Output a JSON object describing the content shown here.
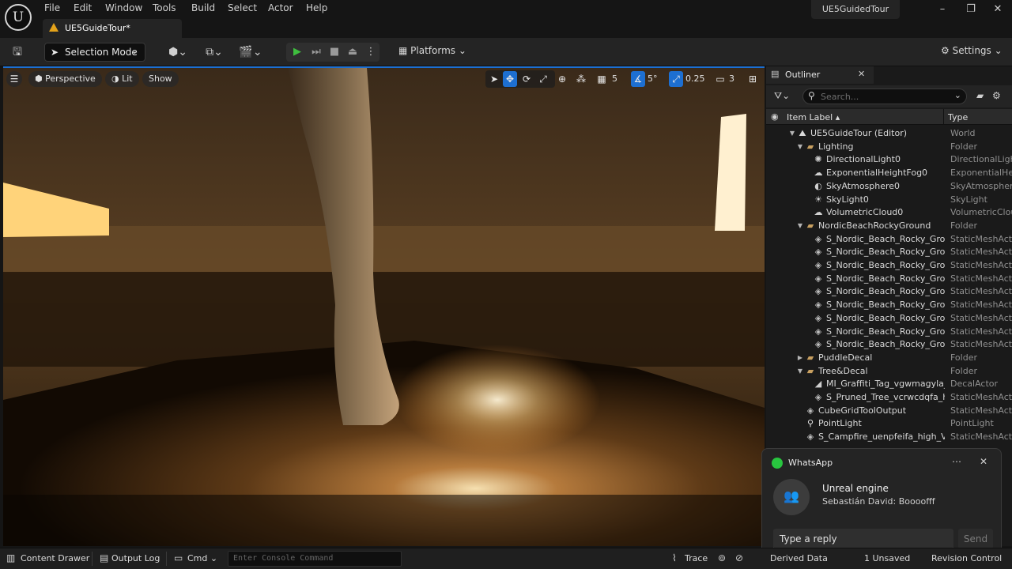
{
  "menu": {
    "items": [
      "File",
      "Edit",
      "Window",
      "Tools",
      "Build",
      "Select",
      "Actor",
      "Help"
    ]
  },
  "document_tab": {
    "label": "UE5GuideTour*"
  },
  "project_name": "UE5GuidedTour",
  "toolbar": {
    "mode": "Selection Mode",
    "platforms": "Platforms",
    "settings": "Settings"
  },
  "viewport": {
    "perspective": "Perspective",
    "lit": "Lit",
    "show": "Show",
    "grid_snap": "5",
    "angle_snap": "5°",
    "scale_snap": "0.25",
    "camera_speed": "3"
  },
  "outliner": {
    "tab_label": "Outliner",
    "search_placeholder": "Search...",
    "col_label": "Item Label ▴",
    "col_type": "Type",
    "rows": [
      {
        "depth": 0,
        "twisty": "▼",
        "icon": "⛰",
        "icon_name": "world-icon",
        "label": "UE5GuideTour (Editor)",
        "type": "World"
      },
      {
        "depth": 1,
        "twisty": "▼",
        "icon": "▰",
        "icon_name": "folder-open-icon",
        "label": "Lighting",
        "type": "Folder"
      },
      {
        "depth": 2,
        "twisty": "",
        "icon": "✺",
        "icon_name": "directional-light-icon",
        "label": "DirectionalLight0",
        "type": "DirectionalLight"
      },
      {
        "depth": 2,
        "twisty": "",
        "icon": "☁",
        "icon_name": "height-fog-icon",
        "label": "ExponentialHeightFog0",
        "type": "ExponentialHeightFog"
      },
      {
        "depth": 2,
        "twisty": "",
        "icon": "◐",
        "icon_name": "sky-atmosphere-icon",
        "label": "SkyAtmosphere0",
        "type": "SkyAtmosphere"
      },
      {
        "depth": 2,
        "twisty": "",
        "icon": "☀",
        "icon_name": "skylight-icon",
        "label": "SkyLight0",
        "type": "SkyLight"
      },
      {
        "depth": 2,
        "twisty": "",
        "icon": "☁",
        "icon_name": "volumetric-cloud-icon",
        "label": "VolumetricCloud0",
        "type": "VolumetricCloud"
      },
      {
        "depth": 1,
        "twisty": "▼",
        "icon": "▰",
        "icon_name": "folder-open-icon",
        "label": "NordicBeachRockyGround",
        "type": "Folder"
      },
      {
        "depth": 2,
        "twisty": "",
        "icon": "◈",
        "icon_name": "static-mesh-icon",
        "label": "S_Nordic_Beach_Rocky_Ground",
        "type": "StaticMeshActor"
      },
      {
        "depth": 2,
        "twisty": "",
        "icon": "◈",
        "icon_name": "static-mesh-icon",
        "label": "S_Nordic_Beach_Rocky_Ground",
        "type": "StaticMeshActor"
      },
      {
        "depth": 2,
        "twisty": "",
        "icon": "◈",
        "icon_name": "static-mesh-icon",
        "label": "S_Nordic_Beach_Rocky_Ground",
        "type": "StaticMeshActor"
      },
      {
        "depth": 2,
        "twisty": "",
        "icon": "◈",
        "icon_name": "static-mesh-icon",
        "label": "S_Nordic_Beach_Rocky_Ground",
        "type": "StaticMeshActor"
      },
      {
        "depth": 2,
        "twisty": "",
        "icon": "◈",
        "icon_name": "static-mesh-icon",
        "label": "S_Nordic_Beach_Rocky_Ground",
        "type": "StaticMeshActor"
      },
      {
        "depth": 2,
        "twisty": "",
        "icon": "◈",
        "icon_name": "static-mesh-icon",
        "label": "S_Nordic_Beach_Rocky_Ground",
        "type": "StaticMeshActor"
      },
      {
        "depth": 2,
        "twisty": "",
        "icon": "◈",
        "icon_name": "static-mesh-icon",
        "label": "S_Nordic_Beach_Rocky_Ground",
        "type": "StaticMeshActor"
      },
      {
        "depth": 2,
        "twisty": "",
        "icon": "◈",
        "icon_name": "static-mesh-icon",
        "label": "S_Nordic_Beach_Rocky_Ground",
        "type": "StaticMeshActor"
      },
      {
        "depth": 2,
        "twisty": "",
        "icon": "◈",
        "icon_name": "static-mesh-icon",
        "label": "S_Nordic_Beach_Rocky_Ground",
        "type": "StaticMeshActor"
      },
      {
        "depth": 1,
        "twisty": "▶",
        "icon": "▰",
        "icon_name": "folder-icon",
        "label": "PuddleDecal",
        "type": "Folder"
      },
      {
        "depth": 1,
        "twisty": "▼",
        "icon": "▰",
        "icon_name": "folder-open-icon",
        "label": "Tree&Decal",
        "type": "Folder"
      },
      {
        "depth": 2,
        "twisty": "",
        "icon": "◢",
        "icon_name": "decal-icon",
        "label": "MI_Graffiti_Tag_vgwmagyla_",
        "type": "DecalActor"
      },
      {
        "depth": 2,
        "twisty": "",
        "icon": "◈",
        "icon_name": "static-mesh-icon",
        "label": "S_Pruned_Tree_vcrwcdqfa_h",
        "type": "StaticMeshActor"
      },
      {
        "depth": 1,
        "twisty": "",
        "icon": "◈",
        "icon_name": "static-mesh-icon",
        "label": "CubeGridToolOutput",
        "type": "StaticMeshActor"
      },
      {
        "depth": 1,
        "twisty": "",
        "icon": "⚲",
        "icon_name": "point-light-icon",
        "label": "PointLight",
        "type": "PointLight"
      },
      {
        "depth": 1,
        "twisty": "",
        "icon": "◈",
        "icon_name": "static-mesh-icon",
        "label": "S_Campfire_uenpfeifa_high_Va",
        "type": "StaticMeshActor"
      }
    ]
  },
  "notification": {
    "app": "WhatsApp",
    "title": "Unreal engine",
    "message": "Sebastián David: Boooofff",
    "reply_placeholder": "Type a reply",
    "send": "Send"
  },
  "statusbar": {
    "content_drawer": "Content Drawer",
    "output_log": "Output Log",
    "cmd": "Cmd",
    "console_placeholder": "Enter Console Command",
    "trace": "Trace",
    "derived_data": "Derived Data",
    "unsaved": "1 Unsaved",
    "revision_control": "Revision Control"
  },
  "colors": {
    "accent": "#1d6fd1",
    "play_green": "#3fbf3f",
    "warning": "#e3a21a",
    "whatsapp": "#28c53f"
  }
}
